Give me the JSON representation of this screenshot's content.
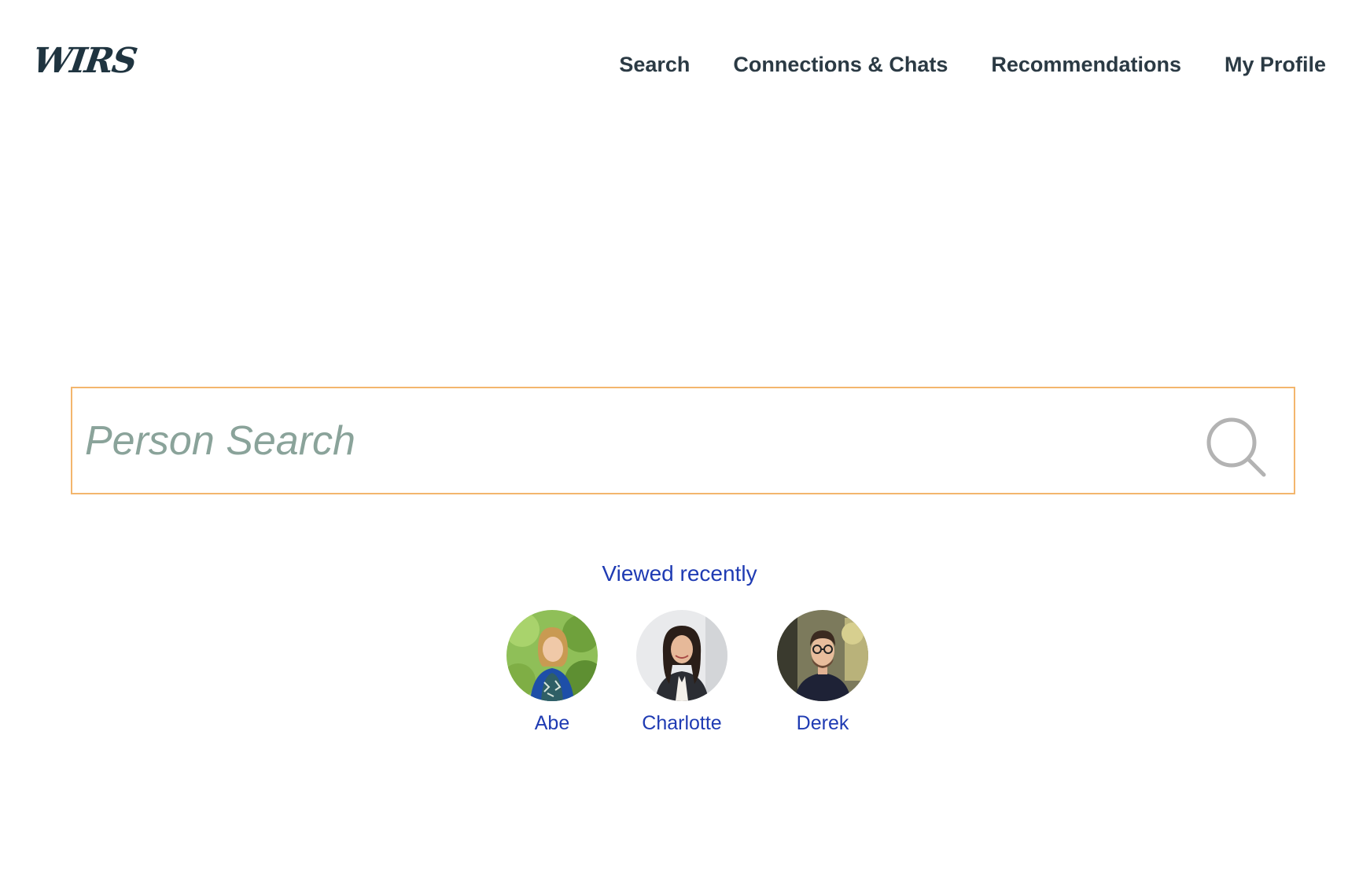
{
  "header": {
    "logo_text": "WIRS",
    "nav": [
      {
        "label": "Search"
      },
      {
        "label": "Connections & Chats"
      },
      {
        "label": "Recommendations"
      },
      {
        "label": "My Profile"
      }
    ]
  },
  "search": {
    "placeholder": "Person Search",
    "value": "",
    "icon": "search-icon"
  },
  "recent": {
    "title": "Viewed recently",
    "people": [
      {
        "name": "Abe"
      },
      {
        "name": "Charlotte"
      },
      {
        "name": "Derek"
      }
    ]
  },
  "colors": {
    "accent_border": "#f3b66d",
    "link_blue": "#1f3bb3",
    "nav_text": "#2b3a44",
    "placeholder": "#8aa39a"
  }
}
